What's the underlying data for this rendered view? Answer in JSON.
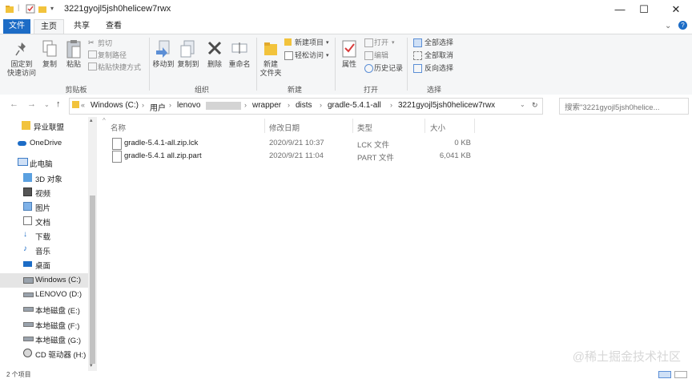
{
  "window": {
    "title": "3221gyojl5jsh0helicew7rwx",
    "minimize": "—",
    "maximize": "☐",
    "close": "✕"
  },
  "ribbon_tabs": [
    {
      "label": "文件"
    },
    {
      "label": "主页"
    },
    {
      "label": "共享"
    },
    {
      "label": "查看"
    }
  ],
  "ribbon": {
    "pin_label": "固定到\n快速访问",
    "copy_label": "复制",
    "paste_label": "粘贴",
    "cut_label": "剪切",
    "copy_path_label": "复制路径",
    "paste_shortcut_label": "粘贴快捷方式",
    "clipboard_group": "剪贴板",
    "move_to_label": "移动到",
    "copy_to_label": "复制到",
    "delete_label": "删除",
    "rename_label": "重命名",
    "organize_group": "组织",
    "new_item_label": "新建项目",
    "easy_access_label": "轻松访问",
    "new_folder_label": "新建\n文件夹",
    "new_group": "新建",
    "properties_label": "属性",
    "open_label": "打开",
    "edit_label": "编辑",
    "history_label": "历史记录",
    "open_group": "打开",
    "select_all_label": "全部选择",
    "select_none_label": "全部取消",
    "invert_label": "反向选择",
    "select_group": "选择"
  },
  "address": {
    "crumbs": [
      "Windows (C:)",
      "用户",
      "lenovo",
      "wrapper",
      "dists",
      "gradle-5.4.1-all",
      "3221gyojl5jsh0helicew7rwx"
    ],
    "search_placeholder": "搜索\"3221gyojl5jsh0helice..."
  },
  "nav_pane": [
    {
      "label": "异业联盟",
      "icon": "folder-icon"
    },
    {
      "label": "OneDrive",
      "icon": "cloud-icon"
    },
    {
      "label": "此电脑",
      "icon": "computer-icon"
    },
    {
      "label": "3D 对象",
      "icon": "3d-objects-icon"
    },
    {
      "label": "视频",
      "icon": "video-icon"
    },
    {
      "label": "图片",
      "icon": "pictures-icon"
    },
    {
      "label": "文档",
      "icon": "documents-icon"
    },
    {
      "label": "下载",
      "icon": "download-icon"
    },
    {
      "label": "音乐",
      "icon": "music-icon"
    },
    {
      "label": "桌面",
      "icon": "desktop-icon"
    },
    {
      "label": "Windows (C:)",
      "icon": "drive-icon"
    },
    {
      "label": "LENOVO (D:)",
      "icon": "drive-icon"
    },
    {
      "label": "本地磁盘 (E:)",
      "icon": "drive-icon"
    },
    {
      "label": "本地磁盘 (F:)",
      "icon": "drive-icon"
    },
    {
      "label": "本地磁盘 (G:)",
      "icon": "drive-icon"
    },
    {
      "label": "CD 驱动器 (H:) N",
      "icon": "cd-drive-icon"
    }
  ],
  "columns": {
    "name": "名称",
    "modified": "修改日期",
    "type": "类型",
    "size": "大小"
  },
  "files": [
    {
      "name": "gradle-5.4.1-all.zip.lck",
      "modified": "2020/9/21 10:37",
      "type": "LCK 文件",
      "size": "0 KB"
    },
    {
      "name": "gradle-5.4.1 all.zip.part",
      "modified": "2020/9/21 11:04",
      "type": "PART 文件",
      "size": "6,041 KB"
    }
  ],
  "status": {
    "text": "2 个项目"
  },
  "watermark": "@稀土掘金技术社区",
  "colors": {
    "accent": "#1c6cc6",
    "selection": "#e5e5e5",
    "ribbon_bg": "#f5f6f7"
  }
}
